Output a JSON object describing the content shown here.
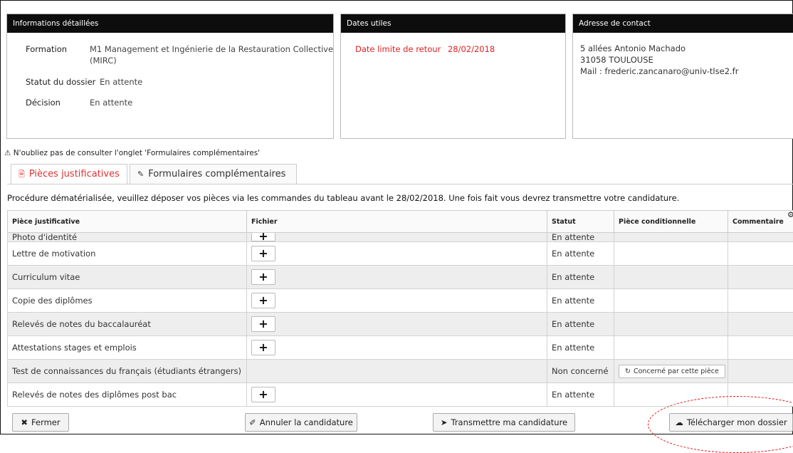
{
  "panels": {
    "info": {
      "title": "Informations détaillées",
      "formation_label": "Formation",
      "formation_value_line1": "M1 Management et Ingénierie de la Restauration Collective",
      "formation_value_line2": "(MIRC)",
      "statut_label": "Statut du dossier",
      "statut_value": "En attente",
      "decision_label": "Décision",
      "decision_value": "En attente"
    },
    "dates": {
      "title": "Dates utiles",
      "deadline_label": "Date limite de retour",
      "deadline_value": "28/02/2018"
    },
    "contact": {
      "title": "Adresse de contact",
      "line1": "5 allées Antonio Machado",
      "line2": "31058 TOULOUSE",
      "line3": "Mail : frederic.zancanaro@univ-tlse2.fr"
    }
  },
  "notice": "N'oubliez pas de consulter l'onglet 'Formulaires complémentaires'",
  "tabs": [
    {
      "label": "Pièces justificatives",
      "icon": "file-icon",
      "active": true
    },
    {
      "label": "Formulaires complémentaires",
      "icon": "edit-icon",
      "active": false
    }
  ],
  "procedure_text": "Procédure dématérialisée, veuillez déposer vos pièces via les commandes du tableau avant le 28/02/2018. Une fois fait vous devrez transmettre votre candidature.",
  "table": {
    "headers": [
      "Pièce justificative",
      "Fichier",
      "Statut",
      "Pièce conditionnelle",
      "Commentaire"
    ],
    "rows": [
      {
        "piece": "Photo d'identité",
        "statut": "En attente"
      },
      {
        "piece": "Lettre de motivation",
        "statut": "En attente"
      },
      {
        "piece": "Curriculum vitae",
        "statut": "En attente"
      },
      {
        "piece": "Copie des diplômes",
        "statut": "En attente"
      },
      {
        "piece": "Relevés de notes du baccalauréat",
        "statut": "En attente"
      },
      {
        "piece": "Attestations stages et emplois",
        "statut": "En attente"
      },
      {
        "piece": "Test de connaissances du français (étudiants étrangers)",
        "statut": "Non concerné",
        "conditional_button": "Concerné par cette pièce"
      },
      {
        "piece": "Relevés de notes des diplômes post bac",
        "statut": "En attente"
      }
    ]
  },
  "buttons": {
    "fermer": "Fermer",
    "annuler": "Annuler la candidature",
    "transmettre": "Transmettre ma candidature",
    "telecharger": "Télécharger mon dossier"
  },
  "colors": {
    "panel_header": "#0d0d0d",
    "accent_red": "#dd2222",
    "row_alt": "#eeeeee"
  }
}
